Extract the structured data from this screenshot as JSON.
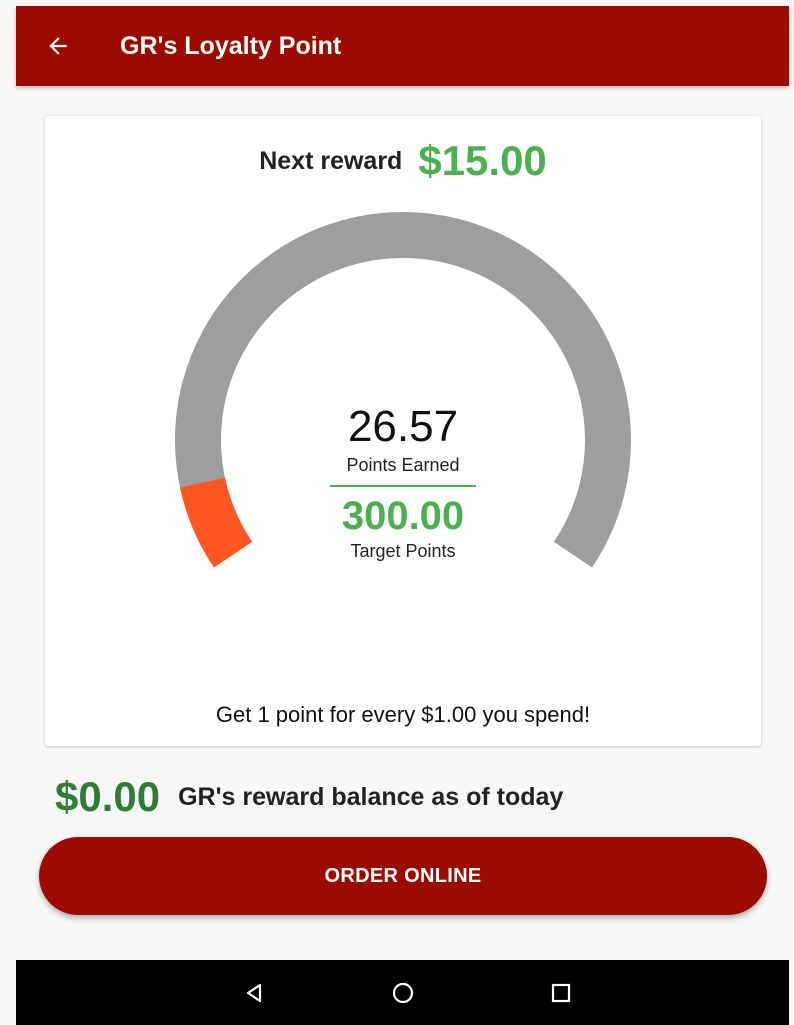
{
  "app_bar": {
    "title": "GR's Loyalty Point",
    "back_icon": "arrow-left-icon",
    "color": "#9c0b00"
  },
  "reward": {
    "label": "Next reward",
    "amount": "$15.00"
  },
  "gauge": {
    "points_earned": "26.57",
    "points_earned_label": "Points Earned",
    "target_points": "300.00",
    "target_points_label": "Target Points",
    "progress_fraction": 0.0886,
    "track_color": "#9e9e9e",
    "progress_color": "#ff5722"
  },
  "earn_note": "Get 1 point for every $1.00 you spend!",
  "balance": {
    "amount": "$0.00",
    "label": "GR's reward balance as of today"
  },
  "order_button": {
    "label": "ORDER ONLINE"
  },
  "nav_bar": {
    "back_icon": "triangle-back-icon",
    "home_icon": "circle-home-icon",
    "recents_icon": "square-recents-icon"
  },
  "colors": {
    "accent_green": "#4caf50",
    "balance_green": "#2e7d32"
  }
}
